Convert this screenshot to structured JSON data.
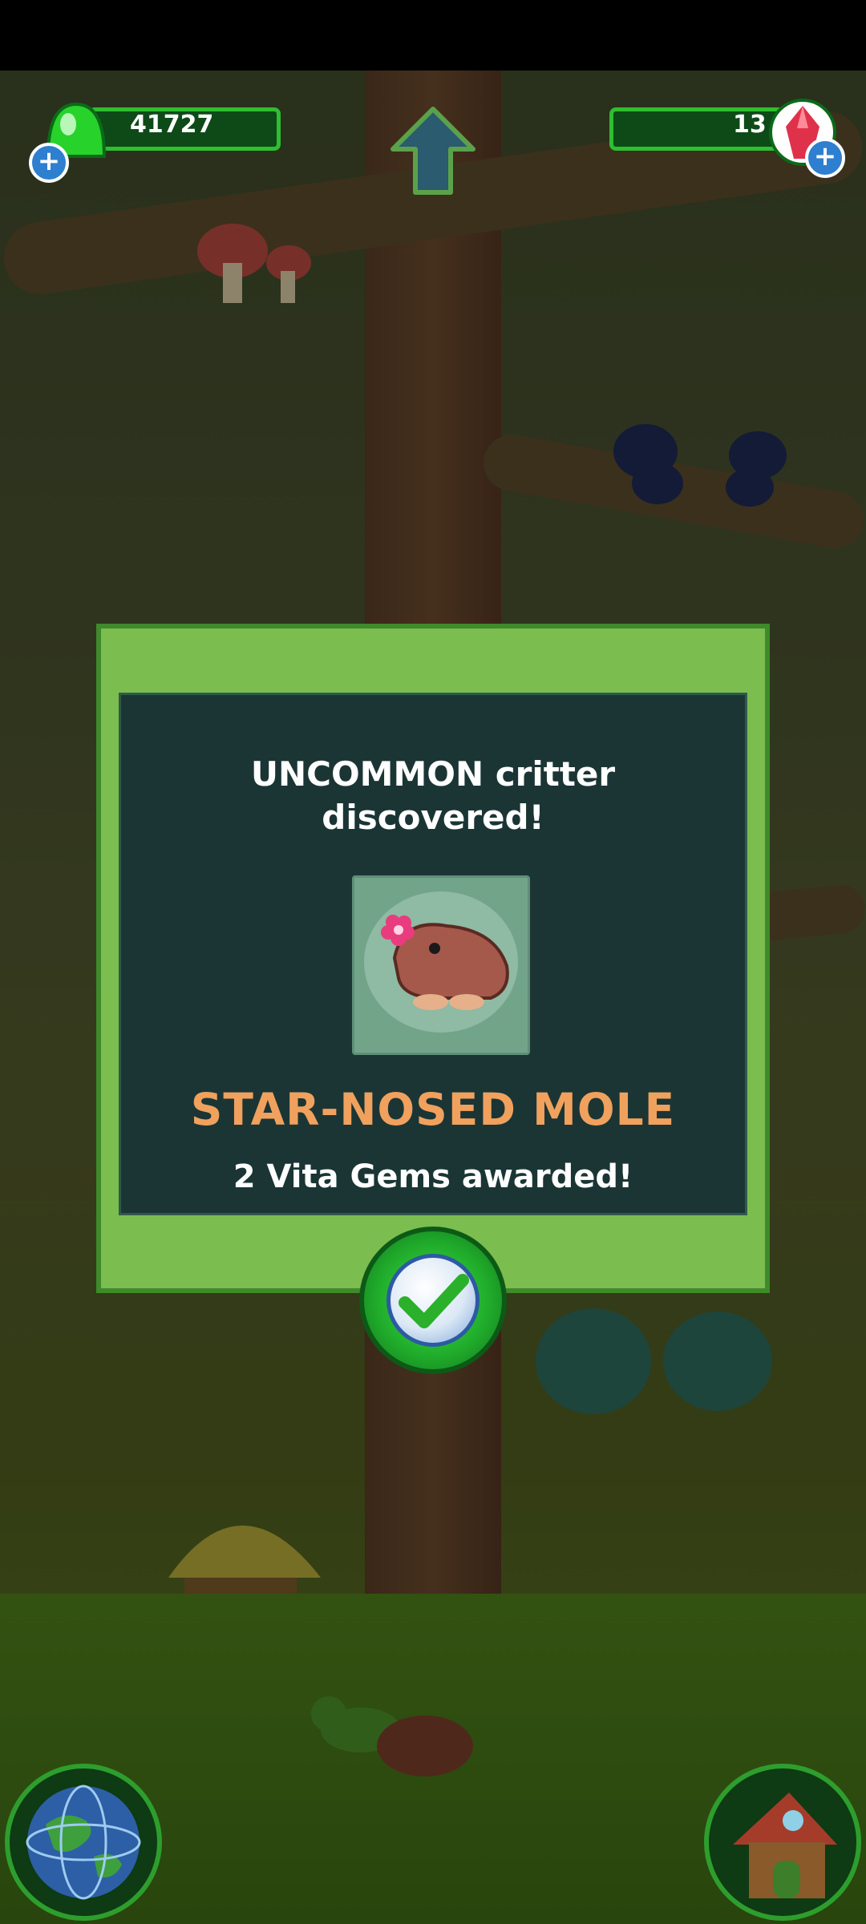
{
  "hud": {
    "coins_value": "41727",
    "gems_value": "13"
  },
  "modal": {
    "headline": "UNCOMMON critter\ndiscovered!",
    "critter_name": "STAR-NOSED MOLE",
    "award_text": "2 Vita Gems awarded!"
  },
  "colors": {
    "modal_frame": "#7cbd50",
    "modal_panel": "#1b3535",
    "critter_name": "#f0a15d",
    "hud_bar": "#0d4a17"
  },
  "icons": {
    "coins": "green-slime-icon",
    "gems": "red-crystal-icon",
    "up": "up-arrow-icon",
    "confirm": "checkmark-icon",
    "world": "globe-icon",
    "home": "house-icon"
  }
}
